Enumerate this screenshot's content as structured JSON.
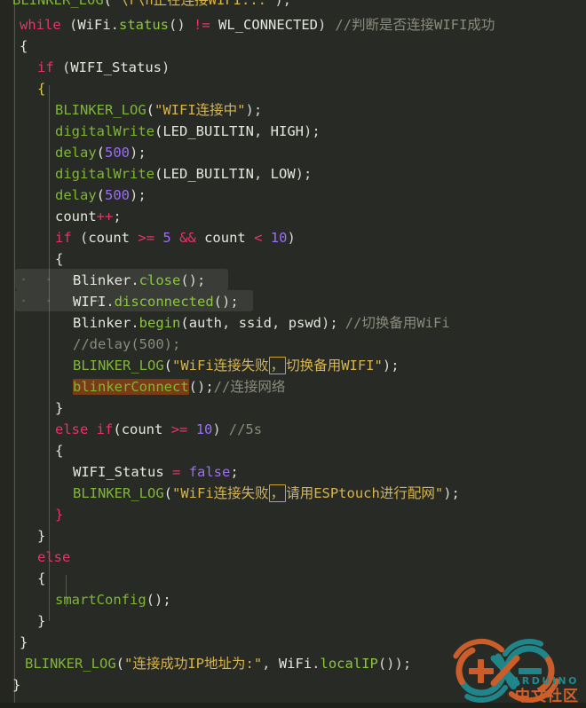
{
  "editor": {
    "language": "arduino-cpp",
    "background_color": "#282a25",
    "foreground_color": "#d8d8d2",
    "line_height_px": 24,
    "font_size_px": 15.5
  },
  "colors": {
    "keyword": "#e8336d",
    "function": "#7fb733",
    "string": "#d8b44a",
    "number": "#9b6ef3",
    "comment": "#8a8a7d",
    "identifier": "#e6e6e0",
    "operator": "#e8336d",
    "selection": "rgba(255,255,255,0.085)",
    "occurrence_highlight": "#7a3c16",
    "unicode_box_border": "#cfa32b",
    "gutter": "#24261f",
    "indent_guide": "#55574e"
  },
  "code": {
    "line_00_clipped": {
      "fn": "BLINKER_LOG",
      "open": "(",
      "str": "\"\\r\\n正在连接WIFI...\"",
      "close": ");"
    },
    "line_01": {
      "kw": "while",
      "t1": " (",
      "id1": "WiFi",
      "dot": ".",
      "fn1": "status",
      "t2": "() ",
      "op1": "!=",
      "t3": " ",
      "const1": "WL_CONNECTED",
      "t4": ")",
      "comment": "//判断是否连接WIFI成功"
    },
    "line_02": {
      "brace": "{"
    },
    "line_03": {
      "kw": "if",
      "t1": " (",
      "id": "WIFI_Status",
      "t2": ")"
    },
    "line_04": {
      "brace": "{"
    },
    "line_05": {
      "fn": "BLINKER_LOG",
      "open": "(",
      "str": "\"WIFI连接中\"",
      "close": ");"
    },
    "line_06": {
      "fn": "digitalWrite",
      "open": "(",
      "a1": "LED_BUILTIN",
      "sep": ", ",
      "a2": "HIGH",
      "close": ");"
    },
    "line_07": {
      "fn": "delay",
      "open": "(",
      "num": "500",
      "close": ");"
    },
    "line_08": {
      "fn": "digitalWrite",
      "open": "(",
      "a1": "LED_BUILTIN",
      "sep": ", ",
      "a2": "LOW",
      "close": ");"
    },
    "line_09": {
      "fn": "delay",
      "open": "(",
      "num": "500",
      "close": ");"
    },
    "line_10": {
      "id": "count",
      "op": "++",
      "semi": ";"
    },
    "line_11": {
      "kw": "if",
      "t1": " (",
      "id1": "count",
      "t2": " ",
      "op1": ">=",
      "t3": " ",
      "n1": "5",
      "t4": " ",
      "op2": "&&",
      "t5": " ",
      "id2": "count",
      "t6": " ",
      "op3": "<",
      "t7": " ",
      "n2": "10",
      "t8": ")"
    },
    "line_12": {
      "brace": "{"
    },
    "line_13": {
      "id": "Blinker",
      "dot": ".",
      "fn": "close",
      "close": "();",
      "selected": true
    },
    "line_14": {
      "id": "WIFI",
      "dot": ".",
      "fn": "disconnected",
      "close": "();",
      "selected": true
    },
    "line_15": {
      "id": "Blinker",
      "dot": ".",
      "fn": "begin",
      "open": "(",
      "a1": "auth",
      "s1": ", ",
      "a2": "ssid",
      "s2": ", ",
      "a3": "pswd",
      "close": ");",
      "comment": "//切换备用WiFi"
    },
    "line_16": {
      "comment": "//delay(500);"
    },
    "line_17": {
      "fn": "BLINKER_LOG",
      "open": "(",
      "q1": "\"",
      "s_pre": "WiFi连接失败",
      "s_box": "，",
      "s_post": "切换备用WIFI",
      "q2": "\"",
      "close": ");"
    },
    "line_18": {
      "fn_highlight": "blinkerConnect",
      "close": "();",
      "comment": "//连接网络"
    },
    "line_19": {
      "brace": "}"
    },
    "line_20": {
      "kw1": "else",
      "sp": " ",
      "kw2": "if",
      "t1": "(",
      "id": "count",
      "t2": " ",
      "op": ">=",
      "t3": " ",
      "num": "10",
      "t4": ")",
      "comment": "//5s"
    },
    "line_21": {
      "brace": "{"
    },
    "line_22": {
      "id": "WIFI_Status",
      "t1": " ",
      "op": "=",
      "t2": " ",
      "kw": "false",
      "semi": ";"
    },
    "line_23": {
      "fn": "BLINKER_LOG",
      "open": "(",
      "q1": "\"",
      "s_pre": "WiFi连接失败",
      "s_box": "，",
      "s_post": "请用ESPtouch进行配网",
      "q2": "\"",
      "close": ");"
    },
    "line_24": {
      "brace": "}"
    },
    "line_25": {
      "brace": "}"
    },
    "line_26": {
      "kw": "else"
    },
    "line_27": {
      "brace": "{"
    },
    "line_28": {
      "fn": "smartConfig",
      "close": "();"
    },
    "line_29": {
      "brace": "}"
    },
    "line_30": {
      "brace": "}"
    },
    "line_31": {
      "fn": "BLINKER_LOG",
      "open": "(",
      "str": "\"连接成功IP地址为:\"",
      "sep": ", ",
      "id": "WiFi",
      "dot": ".",
      "fn2": "localIP",
      "close": "());"
    },
    "line_32": {
      "brace": "}"
    }
  },
  "watermark": {
    "brand": "ARDUINO",
    "subtitle": "中文社区",
    "logo_colors": {
      "teal": "#1f8a8f",
      "orange": "#d3602a"
    }
  }
}
